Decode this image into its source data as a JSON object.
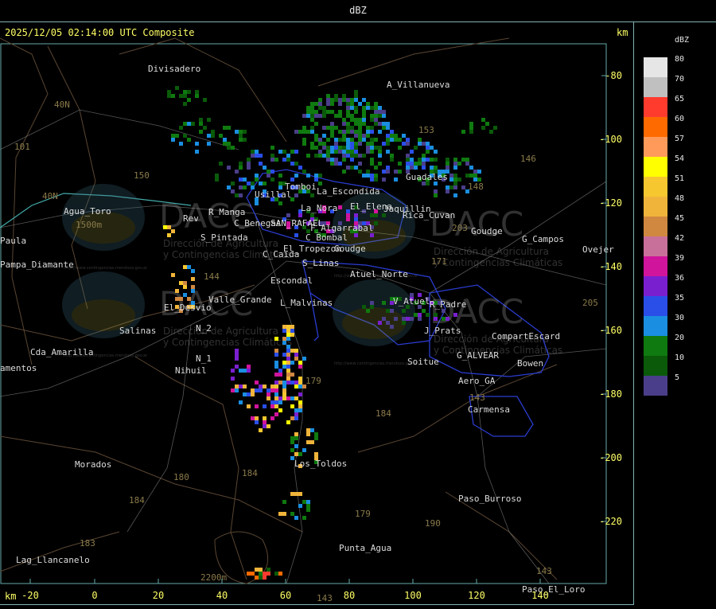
{
  "window": {
    "title": "dBZ"
  },
  "map": {
    "timestamp": "2025/12/05 02:14:00 UTC Composite",
    "unit_top": "km",
    "unit_bottom": "km",
    "x_ticks": [
      "-20",
      "0",
      "20",
      "40",
      "60",
      "80",
      "100",
      "120",
      "140"
    ],
    "y_ticks": [
      "-80",
      "-100",
      "-120",
      "-140",
      "-160",
      "-180",
      "-200",
      "-220"
    ],
    "places": [
      {
        "name": "Divisadero"
      },
      {
        "name": "A_Villanueva"
      },
      {
        "name": "Guadales"
      },
      {
        "name": "Tomboi"
      },
      {
        "name": "La_Escondida"
      },
      {
        "name": "Usillal"
      },
      {
        "name": "La_Nora"
      },
      {
        "name": "El_Elena"
      },
      {
        "name": "Jaquillin"
      },
      {
        "name": "Rica_Cuvan"
      },
      {
        "name": "Goudge"
      },
      {
        "name": "G_Campos"
      },
      {
        "name": "Ovejer"
      },
      {
        "name": "Agua_Toro"
      },
      {
        "name": "Rev"
      },
      {
        "name": "R_Manga"
      },
      {
        "name": "C_Benegas"
      },
      {
        "name": "SAN_RAFAEL"
      },
      {
        "name": "F_Algarrabal"
      },
      {
        "name": "C_Bombal"
      },
      {
        "name": "S_Pintada"
      },
      {
        "name": "El_Tropezon"
      },
      {
        "name": "Goudge"
      },
      {
        "name": "Paula"
      },
      {
        "name": "Pampa_Diamante"
      },
      {
        "name": "C_Caida"
      },
      {
        "name": "S_Linas"
      },
      {
        "name": "Atuel_Norte"
      },
      {
        "name": "Escondal"
      },
      {
        "name": "V_Atuel"
      },
      {
        "name": "R_Padre"
      },
      {
        "name": "Valle_Grande"
      },
      {
        "name": "L_Malvinas"
      },
      {
        "name": "El_Desvio"
      },
      {
        "name": "Salinas"
      },
      {
        "name": "N_2"
      },
      {
        "name": "N_1"
      },
      {
        "name": "J_Prats"
      },
      {
        "name": "CompartEscard"
      },
      {
        "name": "G_ALVEAR"
      },
      {
        "name": "Bowen"
      },
      {
        "name": "Soitue"
      },
      {
        "name": "Aero_GA"
      },
      {
        "name": "Carmensa"
      },
      {
        "name": "Cda_Amarilla"
      },
      {
        "name": "amentos"
      },
      {
        "name": "Nihuil"
      },
      {
        "name": "Los_Toldos"
      },
      {
        "name": "Morados"
      },
      {
        "name": "Paso_Burroso"
      },
      {
        "name": "Punta_Agua"
      },
      {
        "name": "Lag_Llancanelo"
      },
      {
        "name": "Paso_El_Loro"
      },
      {
        "name": "40N"
      },
      {
        "name": "40N"
      },
      {
        "name": "101"
      },
      {
        "name": "150"
      },
      {
        "name": "153"
      },
      {
        "name": "146"
      },
      {
        "name": "148"
      },
      {
        "name": "203"
      },
      {
        "name": "171"
      },
      {
        "name": "144"
      },
      {
        "name": "143"
      },
      {
        "name": "179"
      },
      {
        "name": "184"
      },
      {
        "name": "180"
      },
      {
        "name": "184"
      },
      {
        "name": "179"
      },
      {
        "name": "190"
      },
      {
        "name": "205"
      },
      {
        "name": "143"
      },
      {
        "name": "184"
      },
      {
        "name": "183"
      },
      {
        "name": "143"
      },
      {
        "name": "1500m"
      },
      {
        "name": "2200m"
      }
    ],
    "watermarks": [
      {
        "brand": "DACC",
        "org_line1": "Dirección de Agricultura",
        "org_line2": "y Contingencias Climáticas",
        "url": "http://www.contingencias.mendoza.gov.ar"
      }
    ]
  },
  "legend": {
    "title": "dBZ",
    "levels": [
      {
        "label": "80",
        "color": "#e6e6e6"
      },
      {
        "label": "70",
        "color": "#c0c0c0"
      },
      {
        "label": "65",
        "color": "#ff3b2e"
      },
      {
        "label": "60",
        "color": "#ff6a00"
      },
      {
        "label": "57",
        "color": "#ff9a5a"
      },
      {
        "label": "54",
        "color": "#ffff00"
      },
      {
        "label": "51",
        "color": "#f7c72f"
      },
      {
        "label": "48",
        "color": "#f0b43a"
      },
      {
        "label": "45",
        "color": "#d08840"
      },
      {
        "label": "42",
        "color": "#c8709a"
      },
      {
        "label": "39",
        "color": "#d0149c"
      },
      {
        "label": "36",
        "color": "#7a1fd0"
      },
      {
        "label": "35",
        "color": "#2a4ee8"
      },
      {
        "label": "30",
        "color": "#1a8ee0"
      },
      {
        "label": "20",
        "color": "#0f7a0f"
      },
      {
        "label": "10",
        "color": "#0a5a0a"
      },
      {
        "label": "5",
        "color": "#4a3e8a"
      }
    ]
  }
}
